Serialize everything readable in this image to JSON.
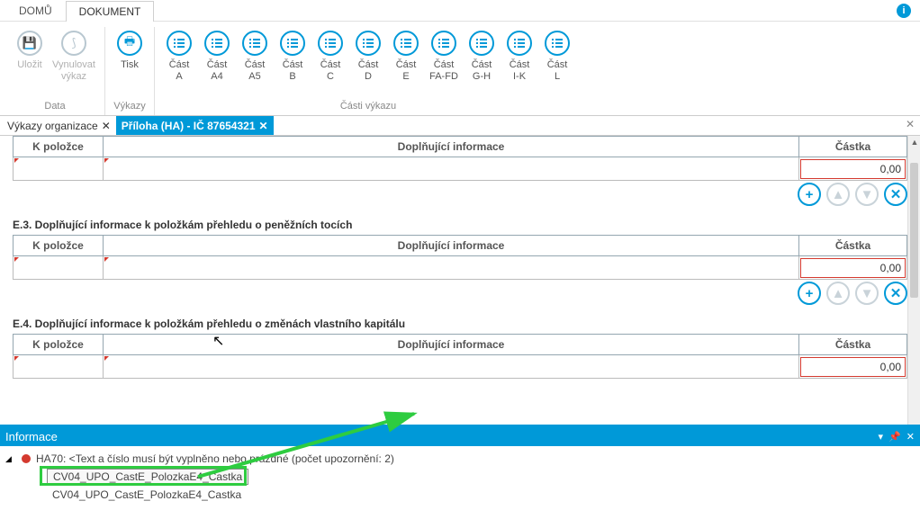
{
  "top_tabs": {
    "home": "DOMŮ",
    "document": "DOKUMENT"
  },
  "ribbon": {
    "data_group": "Data",
    "vykazy_group": "Výkazy",
    "casti_group": "Části výkazu",
    "save": "Uložit",
    "reset": "Vynulovat\nvýkaz",
    "print": "Tisk",
    "parts": [
      {
        "top": "Část",
        "bot": "A"
      },
      {
        "top": "Část",
        "bot": "A4"
      },
      {
        "top": "Část",
        "bot": "A5"
      },
      {
        "top": "Část",
        "bot": "B"
      },
      {
        "top": "Část",
        "bot": "C"
      },
      {
        "top": "Část",
        "bot": "D"
      },
      {
        "top": "Část",
        "bot": "E"
      },
      {
        "top": "Část",
        "bot": "FA-FD"
      },
      {
        "top": "Část",
        "bot": "G-H"
      },
      {
        "top": "Část",
        "bot": "I-K"
      },
      {
        "top": "Část",
        "bot": "L"
      }
    ]
  },
  "doc_tabs": {
    "first": "Výkazy organizace",
    "second": "Příloha (HA) - IČ 87654321"
  },
  "columns": {
    "k": "K položce",
    "info": "Doplňující informace",
    "amount": "Částka"
  },
  "amount_zero": "0,00",
  "sections": {
    "e3": "E.3. Doplňující informace k položkám přehledu o peněžních tocích",
    "e4": "E.4. Doplňující informace k položkám přehledu o změnách vlastního kapitálu"
  },
  "info_panel": {
    "title": "Informace",
    "line1": "HA70: <Text a číslo musí být vyplněno nebo prázdné (počet upozornění: 2)",
    "item": "CV04_UPO_CastE_PolozkaE4_Castka"
  }
}
